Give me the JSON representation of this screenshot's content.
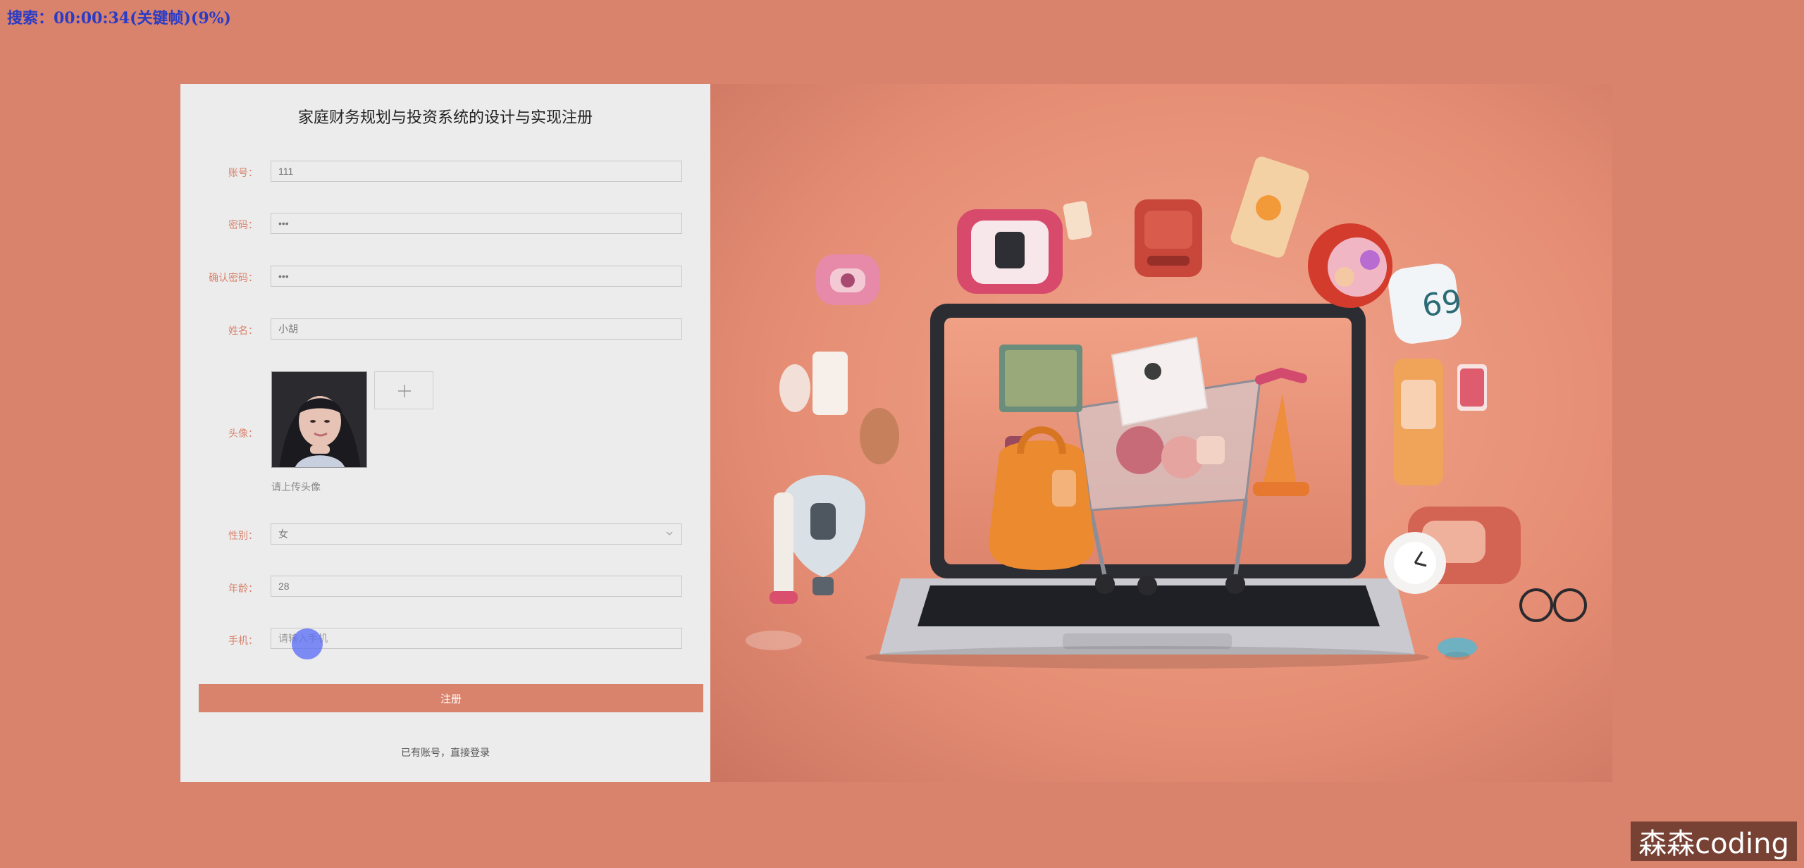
{
  "overlay": {
    "search_status": "搜索：00:00:34(关键帧)(9%)"
  },
  "register": {
    "title": "家庭财务规划与投资系统的设计与实现注册",
    "fields": [
      {
        "label": "账号：",
        "value": "111"
      },
      {
        "label": "密码：",
        "value": "•••"
      },
      {
        "label": "确认密码：",
        "value": "•••"
      },
      {
        "label": "姓名：",
        "value": "小胡"
      }
    ],
    "avatar_label": "头像：",
    "upload_hint": "请上传头像",
    "gender_label": "性别：",
    "gender_value": "女",
    "age_label": "年龄：",
    "age_value": "28",
    "phone_label": "手机：",
    "phone_placeholder": "请输入手机",
    "submit_label": "注册",
    "login_link": "已有账号，直接登录"
  },
  "watermark": {
    "text": "森森coding"
  },
  "colors": {
    "accent": "#d9826c",
    "card_bg": "#ececec",
    "cursor": "#5c6ef6"
  }
}
